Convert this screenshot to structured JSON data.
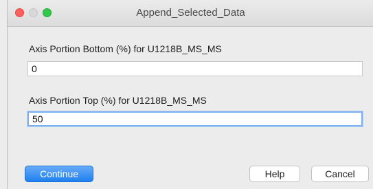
{
  "window": {
    "title": "Append_Selected_Data"
  },
  "form": {
    "bottom": {
      "label": "Axis Portion Bottom (%) for U1218B_MS_MS",
      "value": "0"
    },
    "top": {
      "label": "Axis Portion Top (%) for U1218B_MS_MS",
      "value": "50"
    }
  },
  "buttons": {
    "continue_label": "Continue",
    "help_label": "Help",
    "cancel_label": "Cancel"
  },
  "colors": {
    "close": "#fc605c",
    "minimize": "#d8d8d8",
    "zoom": "#34c84a",
    "accent": "#1f80ef"
  }
}
